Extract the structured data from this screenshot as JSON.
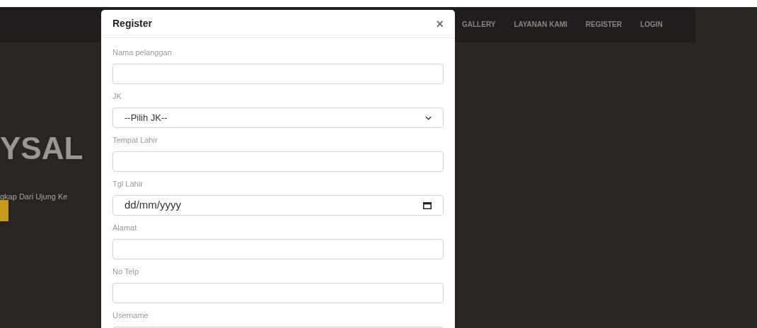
{
  "navbar": {
    "items": [
      {
        "label": "GALLERY"
      },
      {
        "label": "LAYANAN KAMI"
      },
      {
        "label": "REGISTER"
      },
      {
        "label": "LOGIN"
      }
    ]
  },
  "hero": {
    "title": "YSAL",
    "subtitle": "gkap Dari Ujung Ke"
  },
  "modal": {
    "title": "Register",
    "close": "×",
    "fields": [
      {
        "label": "Nama pelanggan",
        "kind": "text",
        "autofilled": false
      },
      {
        "label": "JK",
        "kind": "select",
        "value": "--Pilih JK--",
        "autofilled": false
      },
      {
        "label": "Tempat Lahir",
        "kind": "text",
        "autofilled": false
      },
      {
        "label": "Tgl Lahir",
        "kind": "date",
        "value": "dd/mm/yyyy",
        "autofilled": false
      },
      {
        "label": "Alamat",
        "kind": "text",
        "autofilled": false
      },
      {
        "label": "No Telp",
        "kind": "text",
        "autofilled": false
      },
      {
        "label": "Username",
        "kind": "text",
        "autofilled": true
      }
    ]
  }
}
